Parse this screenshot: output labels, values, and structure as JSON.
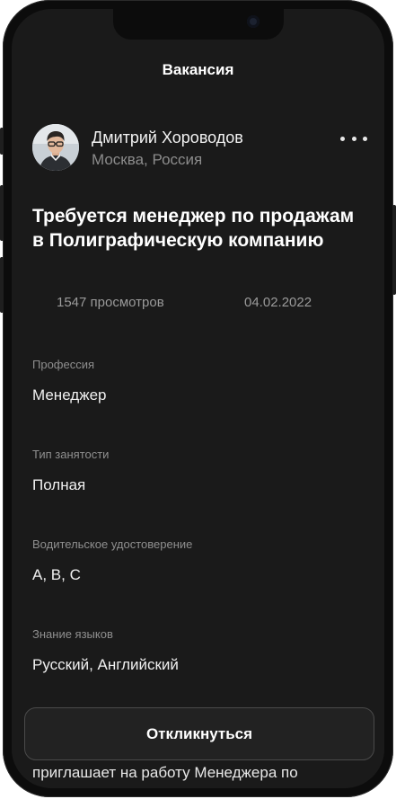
{
  "header": {
    "title": "Вакансия"
  },
  "author": {
    "name": "Дмитрий Хороводов",
    "location": "Москва, Россия",
    "avatar_icon": "person-avatar"
  },
  "menu": {
    "icon": "more-horizontal-icon"
  },
  "vacancy": {
    "title": "Требуется менеджер по продажам в Полиграфическую компанию",
    "views": "1547 просмотров",
    "date": "04.02.2022"
  },
  "fields": [
    {
      "label": "Профессия",
      "value": "Менеджер"
    },
    {
      "label": "Тип занятости",
      "value": "Полная"
    },
    {
      "label": "Водительское удостоверение",
      "value": "A, B, C"
    },
    {
      "label": "Знание языков",
      "value": "Русский, Английский"
    }
  ],
  "description": {
    "visible_text": "приглашает на работу Менеджера по"
  },
  "actions": {
    "respond_label": "Откликнуться"
  },
  "colors": {
    "screen_bg": "#1a1a1a",
    "text_primary": "#ffffff",
    "text_secondary": "#8c8c8c",
    "button_border": "#4a4a4a"
  }
}
